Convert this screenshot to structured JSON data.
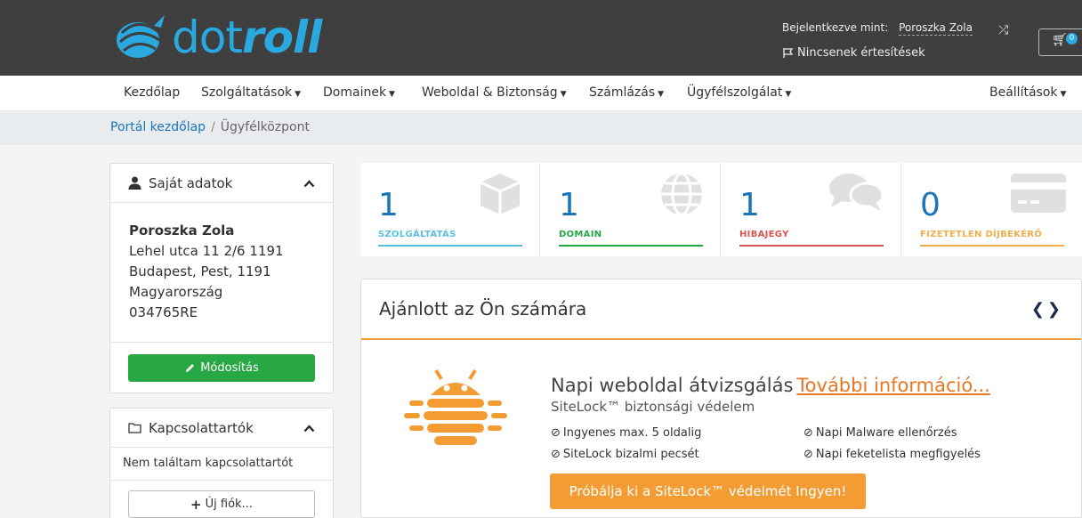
{
  "header": {
    "logo_text": "dot",
    "logo_text_bold": "roll",
    "login_label": "Bejelentkezve mint:",
    "login_name": "Poroszka Zola",
    "notifications": "Nincsenek értesítések",
    "cart_count": "0"
  },
  "nav": {
    "items": [
      {
        "label": "Kezdőlap"
      },
      {
        "label": "Szolgáltatások"
      },
      {
        "label": "Domainek"
      },
      {
        "label": "Weboldal & Biztonság"
      },
      {
        "label": "Számlázás"
      },
      {
        "label": "Ügyfélszolgálat"
      }
    ],
    "settings": "Beállítások"
  },
  "breadcrumb": {
    "home": "Portál kezdőlap",
    "sep": "/",
    "current": "Ügyfélközpont"
  },
  "profile": {
    "title": "Saját adatok",
    "name": "Poroszka Zola",
    "lines": [
      "Lehel utca 11 2/6 1191",
      "Budapest, Pest, 1191",
      "Magyarország",
      "034765RE"
    ],
    "edit_button": "Módosítás"
  },
  "contacts": {
    "title": "Kapcsolattartók",
    "empty": "Nem találtam kapcsolattartót",
    "new_button": "Új fiók..."
  },
  "stats": [
    {
      "value": "1",
      "label": "SZOLGÁLTATÁS",
      "color": "#5bc0de"
    },
    {
      "value": "1",
      "label": "DOMAIN",
      "color": "#28a745"
    },
    {
      "value": "1",
      "label": "HIBAJEGY",
      "color": "#d9534f"
    },
    {
      "value": "0",
      "label": "FIZETETLEN DÍJBEKÉRŐ",
      "color": "#f0ad4e"
    }
  ],
  "promo": {
    "title": "Ajánlott az Ön számára",
    "heading": "Napi weboldal átvizsgálás",
    "link": "További információ...",
    "subheading": "SiteLock™ biztonsági védelem",
    "features": [
      "Ingyenes max. 5 oldalig",
      "Napi Malware ellenőrzés",
      "SiteLock bizalmi pecsét",
      "Napi feketelista megfigyelés"
    ],
    "button": "Próbálja ki a SiteLock™ védelmét Ingyen!"
  }
}
